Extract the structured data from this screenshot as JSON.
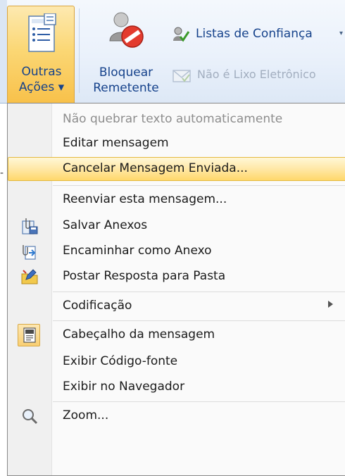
{
  "ribbon": {
    "outras_acoes": {
      "line1": "Outras",
      "line2": "Ações ▾"
    },
    "bloquear": {
      "line1": "Bloquear",
      "line2": "Remetente"
    },
    "listas": {
      "label": "Listas de Confiança",
      "arrow": "▾"
    },
    "nao_lixo": {
      "label": "Não é Lixo Eletrônico"
    },
    "left_mark": "-"
  },
  "menu": {
    "items": [
      {
        "label": "Não quebrar texto automaticamente",
        "icon": "",
        "state": "disabled"
      },
      {
        "label": "Editar mensagem",
        "icon": ""
      },
      {
        "label": "Cancelar Mensagem Enviada...",
        "icon": "",
        "state": "highlighted"
      },
      {
        "label": "Reenviar esta mensagem...",
        "icon": ""
      },
      {
        "label": "Salvar Anexos",
        "icon": "save-attachments-icon"
      },
      {
        "label": "Encaminhar como Anexo",
        "icon": "forward-as-attachment-icon"
      },
      {
        "label": "Postar Resposta para Pasta",
        "icon": "post-reply-to-folder-icon"
      },
      {
        "label": "Codificação",
        "icon": "",
        "submenu": true
      },
      {
        "label": "Cabeçalho da mensagem",
        "icon": "message-header-icon",
        "checked": true
      },
      {
        "label": "Exibir Código-fonte",
        "icon": ""
      },
      {
        "label": "Exibir no Navegador",
        "icon": ""
      },
      {
        "label": "Zoom...",
        "icon": "zoom-magnifier-icon"
      }
    ]
  },
  "colors": {
    "ribbon_text": "#15428b",
    "highlight": "#ffe8a6",
    "disabled_text": "#8d8d8d"
  }
}
